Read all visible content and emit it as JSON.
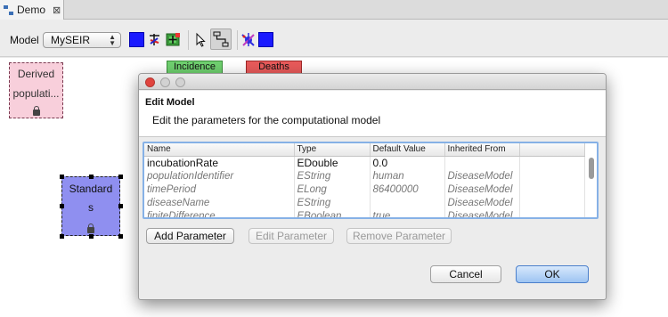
{
  "editor": {
    "tab_label": "Demo",
    "close_glyph": "⊠"
  },
  "toolbar": {
    "model_label": "Model",
    "model_select_value": "MySEIR",
    "icons": [
      "blue-square-icon",
      "decorator-icon",
      "add-node-icon",
      "pointer-icon",
      "connection-icon",
      "splat-icon",
      "blue-square-icon"
    ],
    "accent_blue": "#1a1aff"
  },
  "canvas": {
    "nodes": {
      "derived": {
        "line1": "Derived",
        "line2": "populati...",
        "color": "#f8cfdb"
      },
      "standard": {
        "line1": "Standard",
        "line2": "s",
        "color": "#8f8ff0"
      },
      "incidence": {
        "label": "Incidence",
        "color": "#6fd06f"
      },
      "deaths": {
        "label": "Deaths",
        "color": "#e85a5a"
      }
    }
  },
  "dialog": {
    "title": "Edit Model",
    "subtitle": "Edit the parameters for the computational model",
    "columns": [
      "Name",
      "Type",
      "Default Value",
      "Inherited From"
    ],
    "rows": [
      {
        "name": "incubationRate",
        "type": "EDouble",
        "default": "0.0",
        "inherited": ""
      },
      {
        "name": "populationIdentifier",
        "type": "EString",
        "default": "human",
        "inherited": "DiseaseModel"
      },
      {
        "name": "timePeriod",
        "type": "ELong",
        "default": "86400000",
        "inherited": "DiseaseModel"
      },
      {
        "name": "diseaseName",
        "type": "EString",
        "default": "",
        "inherited": "DiseaseModel"
      },
      {
        "name": "finiteDifference",
        "type": "EBoolean",
        "default": "true",
        "inherited": "DiseaseModel"
      }
    ],
    "buttons": {
      "add": "Add Parameter",
      "edit": "Edit Parameter",
      "remove": "Remove Parameter",
      "cancel": "Cancel",
      "ok": "OK"
    }
  }
}
